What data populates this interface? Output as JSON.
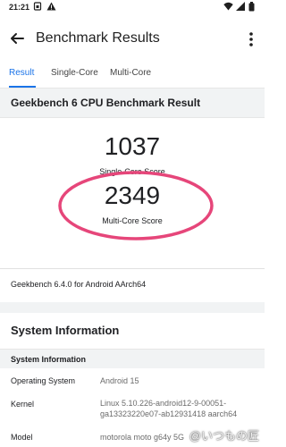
{
  "status_bar": {
    "time": "21:21",
    "left_icons": [
      "sim-icon",
      "alert-icon"
    ],
    "right_icons": [
      "wifi-icon",
      "signal-icon",
      "battery-icon"
    ]
  },
  "app_bar": {
    "title": "Benchmark Results",
    "back_icon": "arrow-back-icon",
    "menu_icon": "more-vert-icon"
  },
  "tabs": [
    {
      "label": "Result",
      "active": true
    },
    {
      "label": "Single-Core",
      "active": false
    },
    {
      "label": "Multi-Core",
      "active": false
    }
  ],
  "result": {
    "header": "Geekbench 6 CPU Benchmark Result",
    "single_core_score": "1037",
    "single_core_label": "Single-Core Score",
    "multi_core_score": "2349",
    "multi_core_label": "Multi-Core Score",
    "version_text": "Geekbench 6.4.0 for Android AArch64"
  },
  "system_information": {
    "title": "System Information",
    "header": "System Information",
    "rows": [
      {
        "key": "Operating System",
        "value": "Android 15"
      },
      {
        "key": "Kernel",
        "value": "Linux 5.10.226-android12-9-00051-ga13323220e07-ab12931418 aarch64"
      },
      {
        "key": "Model",
        "value": "motorola moto g64y 5G"
      }
    ]
  },
  "watermark": "@いつもの匠",
  "colors": {
    "accent": "#1a73e8",
    "highlight_ellipse": "#e6467a",
    "section_bg": "#f1f3f4"
  }
}
